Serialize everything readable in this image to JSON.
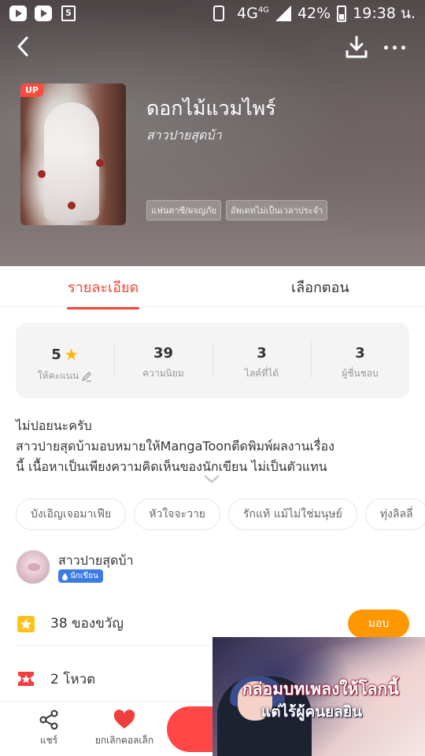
{
  "status_bar": {
    "network": "4G",
    "network_sup": "4G",
    "battery": "42%",
    "time": "19:38 น."
  },
  "book": {
    "cover_badge": "UP",
    "title": "ดอกไม้แวมไพร์",
    "author": "สาวปายสุดบ้า",
    "tags": [
      "แฟนตาซี/ผจญภัย",
      "อัพเดทไม่เป็นเวลาประจำ"
    ]
  },
  "tabs": {
    "details": "รายละเอียด",
    "episodes": "เลือกตอน"
  },
  "stats": [
    {
      "value": "5",
      "label": "ให้คะแนน"
    },
    {
      "value": "39",
      "label": "ความนิยม"
    },
    {
      "value": "3",
      "label": "ไลค์ที่ได้"
    },
    {
      "value": "3",
      "label": "ผู้ชื่นชอบ"
    }
  ],
  "description": {
    "line1": "ไม่ปอยนะครับ",
    "line2": "สาวปายสุดบ้ามอบหมายให้MangaToonตีดพิมพ์ผลงานเรื่อง",
    "line3": "นี้ เนื้อหาเป็นเพียงความคิดเห็นของนักเขียน ไม่เป็นตัวแทน"
  },
  "related_tags": [
    "บังเอิญเจอมาเฟีย",
    "หัวใจจะวาย",
    "รักแท้ แม้ไม่ใช่มนุษย์",
    "ทุ่งลิลลี่"
  ],
  "author_section": {
    "name": "สาวปายสุดบ้า",
    "badge": "นักเขียน"
  },
  "gifts": {
    "text": "38 ของขวัญ",
    "button": "มอบ"
  },
  "votes": {
    "text": "2 โหวต"
  },
  "bottom_bar": {
    "share": "แชร์",
    "unfavorite": "ยกเลิกคอลเล็ก"
  },
  "ad": {
    "line1": "กล่อมบทเพลงให้โลกนี้",
    "line2": "แต่ไร้ผู้คนยลยิน"
  },
  "colors": {
    "accent": "#f24638",
    "gift_button": "#ff9700",
    "read_button": "#ff4747",
    "writer_badge": "#3b7be6",
    "star": "#ffb400"
  }
}
